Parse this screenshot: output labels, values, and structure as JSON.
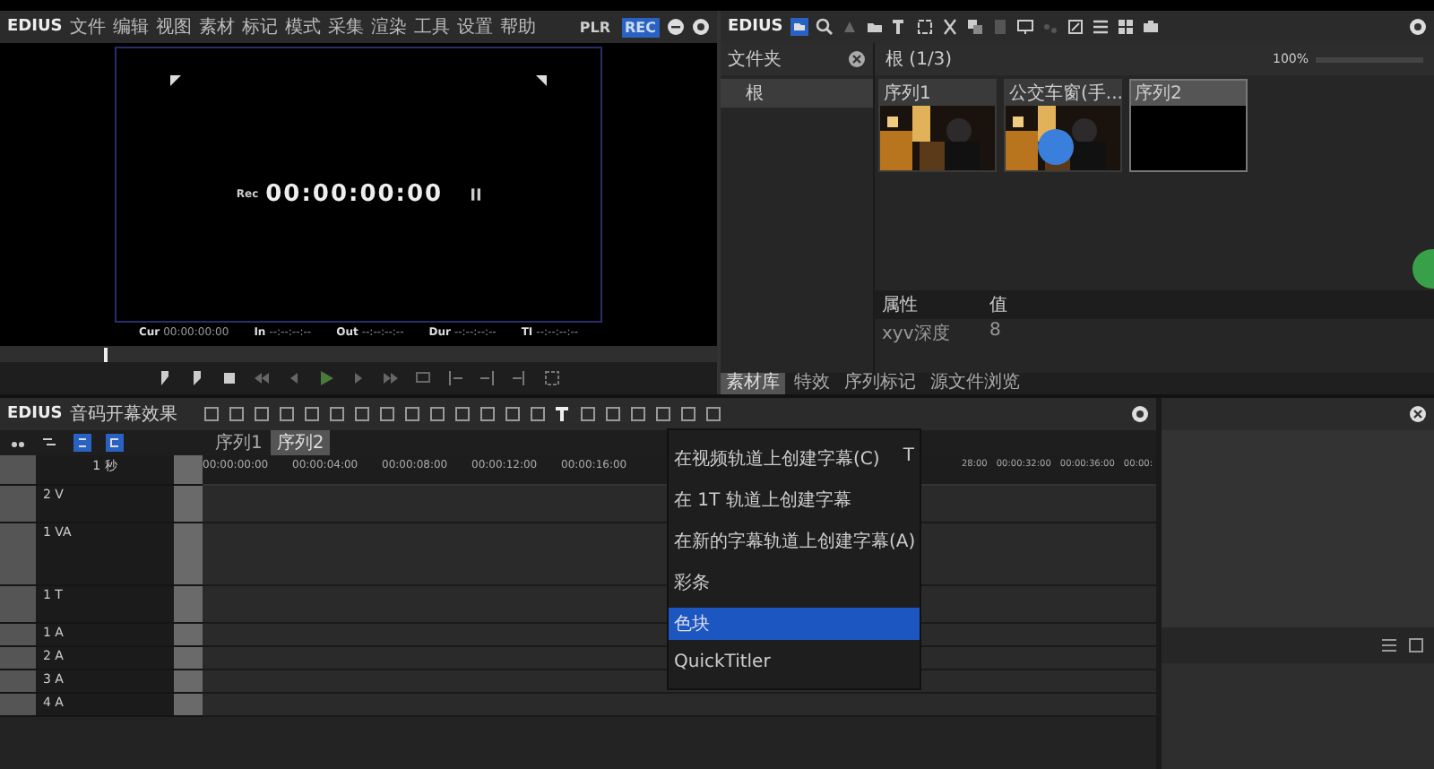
{
  "player": {
    "app": "EDIUS",
    "menu": [
      "文件",
      "编辑",
      "视图",
      "素材",
      "标记",
      "模式",
      "采集",
      "渲染",
      "工具",
      "设置",
      "帮助"
    ],
    "modes": [
      {
        "label": "PLR",
        "selected": false
      },
      {
        "label": "REC",
        "selected": true
      }
    ],
    "timecode_label": "Rec",
    "timecode": "00:00:00:00",
    "readouts": [
      {
        "label": "Cur",
        "value": "00:00:00:00"
      },
      {
        "label": "In",
        "value": "--:--:--:--"
      },
      {
        "label": "Out",
        "value": "--:--:--:--"
      },
      {
        "label": "Dur",
        "value": "--:--:--:--"
      },
      {
        "label": "TI",
        "value": "--:--:--:--"
      }
    ]
  },
  "bin": {
    "app": "EDIUS",
    "tree_title": "文件夹",
    "tree": [
      {
        "label": "根",
        "selected": true
      }
    ],
    "path": "根 (1/3)",
    "zoom": "100%",
    "clips": [
      {
        "label": "序列1",
        "kind": "picture",
        "selected": false
      },
      {
        "label": "公交车窗(手...",
        "kind": "picture",
        "selected": false
      },
      {
        "label": "序列2",
        "kind": "blank",
        "selected": true
      }
    ],
    "properties": {
      "columns": [
        "属性",
        "值"
      ],
      "rows": [
        [
          "xyv深度",
          "8"
        ]
      ]
    },
    "tabs": [
      {
        "label": "素材库",
        "selected": true
      },
      {
        "label": "特效",
        "selected": false
      },
      {
        "label": "序列标记",
        "selected": false
      },
      {
        "label": "源文件浏览",
        "selected": false
      }
    ]
  },
  "timeline": {
    "app": "EDIUS",
    "project": "音码开幕效果",
    "sequences": [
      {
        "label": "序列1",
        "selected": false
      },
      {
        "label": "序列2",
        "selected": true
      }
    ],
    "scale": "1 秒",
    "ruler": [
      "00:00:00:00",
      "00:00:04:00",
      "00:00:08:00",
      "00:00:12:00",
      "00:00:16:00",
      "28:00",
      "00:00:32:00",
      "00:00:36:00",
      "00:00:"
    ],
    "tracks": [
      {
        "name": "2 V",
        "kind": "video"
      },
      {
        "name": "1 VA",
        "kind": "videoaudio"
      },
      {
        "name": "1 T",
        "kind": "title"
      },
      {
        "name": "1 A",
        "kind": "audio"
      },
      {
        "name": "2 A",
        "kind": "audio"
      },
      {
        "name": "3 A",
        "kind": "audio"
      },
      {
        "name": "4 A",
        "kind": "audio"
      }
    ]
  },
  "context_menu": [
    {
      "label": "在视频轨道上创建字幕(C)",
      "shortcut": "T",
      "selected": false
    },
    {
      "label": "在 1T 轨道上创建字幕",
      "selected": false
    },
    {
      "label": "在新的字幕轨道上创建字幕(A)",
      "selected": false
    },
    {
      "label": "彩条",
      "selected": false
    },
    {
      "label": "色块",
      "selected": true
    },
    {
      "label": "QuickTitler",
      "selected": false
    }
  ]
}
